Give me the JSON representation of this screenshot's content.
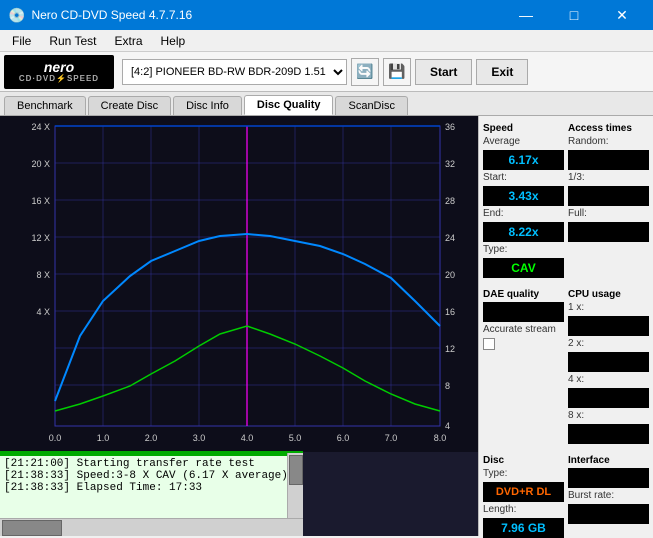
{
  "window": {
    "title": "Nero CD-DVD Speed 4.7.7.16",
    "controls": [
      "—",
      "□",
      "✕"
    ]
  },
  "menu": {
    "items": [
      "File",
      "Run Test",
      "Extra",
      "Help"
    ]
  },
  "toolbar": {
    "logo_nero": "nero",
    "logo_subtitle": "CD·DVD⚡SPEED",
    "drive_label": "[4:2]  PIONEER BD-RW  BDR-209D 1.51",
    "start_label": "Start",
    "exit_label": "Exit"
  },
  "tabs": [
    {
      "label": "Benchmark",
      "active": false
    },
    {
      "label": "Create Disc",
      "active": false
    },
    {
      "label": "Disc Info",
      "active": false
    },
    {
      "label": "Disc Quality",
      "active": true
    },
    {
      "label": "ScanDisc",
      "active": false
    }
  ],
  "right_panel": {
    "speed": {
      "section": "Speed",
      "average_label": "Average",
      "average_value": "6.17x",
      "start_label": "Start:",
      "start_value": "3.43x",
      "end_label": "End:",
      "end_value": "8.22x",
      "type_label": "Type:",
      "type_value": "CAV"
    },
    "access_times": {
      "section": "Access times",
      "random_label": "Random:",
      "random_value": "",
      "third_label": "1/3:",
      "third_value": "",
      "full_label": "Full:",
      "full_value": ""
    },
    "cpu_usage": {
      "section": "CPU usage",
      "1x_label": "1 x:",
      "1x_value": "",
      "2x_label": "2 x:",
      "2x_value": "",
      "4x_label": "4 x:",
      "4x_value": "",
      "8x_label": "8 x:",
      "8x_value": ""
    },
    "dae_quality": {
      "section": "DAE quality",
      "value": ""
    },
    "accurate_stream": {
      "label": "Accurate stream",
      "checked": false
    },
    "disc": {
      "section": "Disc",
      "type_label": "Type:",
      "type_value": "DVD+R DL",
      "length_label": "Length:",
      "length_value": "7.96 GB",
      "interface_label": "Interface",
      "burst_label": "Burst rate:",
      "burst_value": ""
    }
  },
  "chart": {
    "bg_color": "#0d0d1a",
    "grid_color": "#333388",
    "left_axis_labels": [
      "24 X",
      "20 X",
      "16 X",
      "12 X",
      "8 X",
      "4 X"
    ],
    "right_axis_labels": [
      "36",
      "32",
      "28",
      "24",
      "20",
      "16",
      "12",
      "8",
      "4"
    ],
    "bottom_axis_labels": [
      "0.0",
      "1.0",
      "2.0",
      "3.0",
      "4.0",
      "5.0",
      "6.0",
      "7.0",
      "8.0"
    ],
    "magenta_line": "vertical line at x≈4.0",
    "blue_line": "transfer rate curve top",
    "green_line": "seek/access line bottom"
  },
  "log": {
    "entries": [
      "[21:21:00]  Starting transfer rate test",
      "[21:38:33]  Speed:3-8 X CAV (6.17 X average)",
      "[21:38:33]  Elapsed Time: 17:33"
    ]
  },
  "icons": {
    "drive_icon": "💿",
    "save_icon": "💾",
    "refresh_icon": "🔄"
  }
}
